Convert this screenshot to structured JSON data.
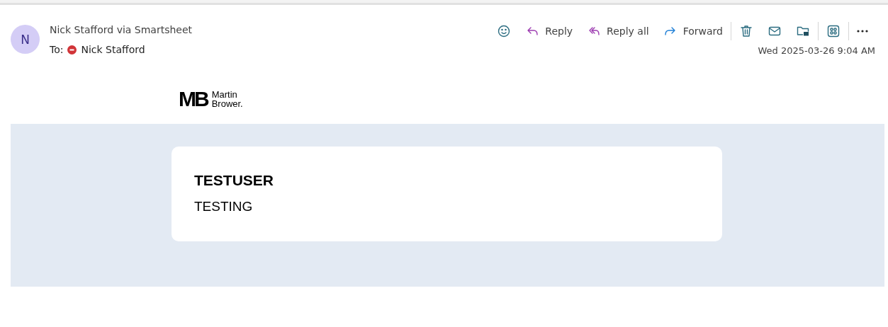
{
  "sender": {
    "avatar": "N",
    "name": "Nick Stafford via Smartsheet"
  },
  "recipient": {
    "label": "To:",
    "name": "Nick Stafford",
    "color": "#d13438"
  },
  "actions": [
    {
      "kind": "emoji"
    },
    {
      "kind": "reply",
      "label": "Reply"
    },
    {
      "kind": "reply_all",
      "label": "Reply all"
    },
    {
      "kind": "forward",
      "label": "Forward"
    },
    {
      "kind": "separator"
    },
    {
      "kind": "delete"
    },
    {
      "kind": "mark_unread"
    },
    {
      "kind": "move"
    },
    {
      "kind": "separator"
    },
    {
      "kind": "apps"
    },
    {
      "kind": "separator"
    },
    {
      "kind": "more"
    }
  ],
  "date": "Wed 2025-03-26 9:04 AM",
  "logo": {
    "mark": "MB",
    "line_1": "Martin",
    "line_2": "Brower."
  },
  "card": {
    "title": "TESTUSER",
    "body": "TESTING"
  }
}
